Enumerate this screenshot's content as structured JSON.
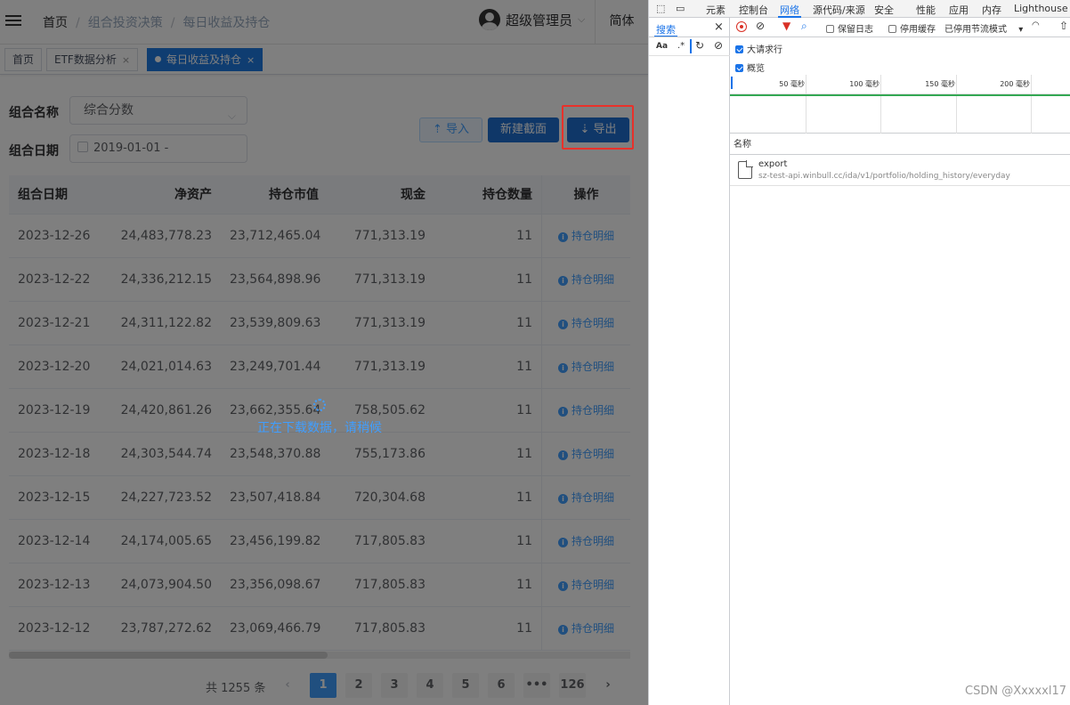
{
  "app": {
    "breadcrumb": [
      "首页",
      "组合投资决策",
      "每日收益及持仓"
    ],
    "user_name": "超级管理员",
    "language": "简体",
    "tabs": [
      {
        "label": "首页",
        "active": false
      },
      {
        "label": "ETF数据分析",
        "active": false,
        "closable": true
      },
      {
        "label": "每日收益及持仓",
        "active": true,
        "closable": true
      }
    ],
    "tab_close": "×",
    "filters": {
      "portfolio_label": "组合名称",
      "portfolio_value": "综合分数",
      "date_label": "组合日期",
      "date_value": "2019-01-01  -"
    },
    "buttons": {
      "import": "导入",
      "new_snapshot": "新建截面",
      "export": "导出"
    },
    "table": {
      "columns": [
        "组合日期",
        "净资产",
        "持仓市值",
        "现金",
        "持仓数量",
        "操作"
      ],
      "action_label": "持仓明细",
      "rows": [
        [
          "2023-12-26",
          "24,483,778.23",
          "23,712,465.04",
          "771,313.19",
          "11"
        ],
        [
          "2023-12-22",
          "24,336,212.15",
          "23,564,898.96",
          "771,313.19",
          "11"
        ],
        [
          "2023-12-21",
          "24,311,122.82",
          "23,539,809.63",
          "771,313.19",
          "11"
        ],
        [
          "2023-12-20",
          "24,021,014.63",
          "23,249,701.44",
          "771,313.19",
          "11"
        ],
        [
          "2023-12-19",
          "24,420,861.26",
          "23,662,355.64",
          "758,505.62",
          "11"
        ],
        [
          "2023-12-18",
          "24,303,544.74",
          "23,548,370.88",
          "755,173.86",
          "11"
        ],
        [
          "2023-12-15",
          "24,227,723.52",
          "23,507,418.84",
          "720,304.68",
          "11"
        ],
        [
          "2023-12-14",
          "24,174,005.65",
          "23,456,199.82",
          "717,805.83",
          "11"
        ],
        [
          "2023-12-13",
          "24,073,904.50",
          "23,356,098.67",
          "717,805.83",
          "11"
        ],
        [
          "2023-12-12",
          "23,787,272.62",
          "23,069,466.79",
          "717,805.83",
          "11"
        ]
      ]
    },
    "pagination": {
      "total_text": "共 1255 条",
      "prev": "‹",
      "next": "›",
      "pages": [
        "1",
        "2",
        "3",
        "4",
        "5",
        "6",
        "•••",
        "126"
      ],
      "current": "1"
    },
    "loading_text": "正在下载数据，请稍候"
  },
  "devtools": {
    "tabs": [
      "元素",
      "控制台",
      "网络",
      "源代码/来源",
      "安全",
      "性能",
      "应用",
      "内存",
      "Lighthouse"
    ],
    "active_tab": "网络",
    "search_tab": "搜索",
    "search_close": "×",
    "toolbar": {
      "preserve_log": "保留日志",
      "disable_cache": "停用缓存",
      "throttling": "已停用节流模式",
      "big_request_rows": "大请求行",
      "overview": "概览"
    },
    "timeline_ticks": [
      "50 毫秒",
      "100 毫秒",
      "150 毫秒",
      "200 毫秒"
    ],
    "name_header": "名称",
    "request": {
      "name": "export",
      "url": "sz-test-api.winbull.cc/ida/v1/portfolio/holding_history/everyday"
    }
  },
  "watermark": "CSDN @Xxxxxl17",
  "colors": {
    "primary": "#1f6fd0",
    "link": "#409eff",
    "highlight": "#e8312a",
    "mask": "rgba(0,0,0,0.5)"
  }
}
